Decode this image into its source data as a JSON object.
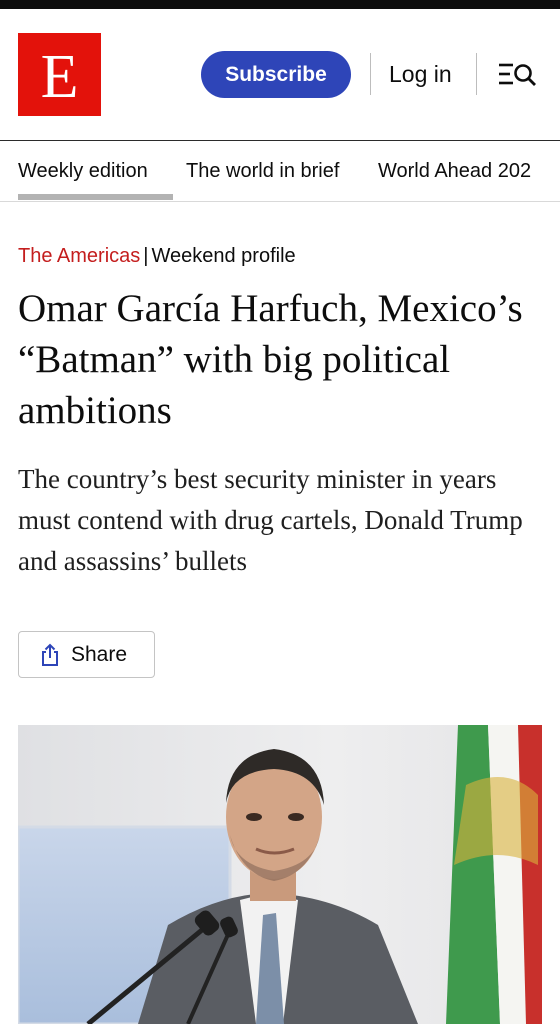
{
  "masthead": {
    "logo_letter": "E"
  },
  "header": {
    "subscribe_label": "Subscribe",
    "login_label": "Log in"
  },
  "nav": {
    "items": [
      "Weekly edition",
      "The world in brief",
      "World Ahead 202"
    ]
  },
  "article": {
    "section": "The Americas",
    "separator": "|",
    "flytitle": "Weekend profile",
    "headline": "Omar García Harfuch, Mexico’s “Batman” with big political ambitions",
    "dek": "The country’s best security minister in years must contend with drug cartels, Donald Trump and assassins’ bullets",
    "share_label": "Share"
  },
  "colors": {
    "brand_red": "#e3120b",
    "subscribe_blue": "#2e45b8",
    "section_red": "#c41e1e"
  },
  "icons": [
    "search-menu-icon",
    "share-icon"
  ]
}
